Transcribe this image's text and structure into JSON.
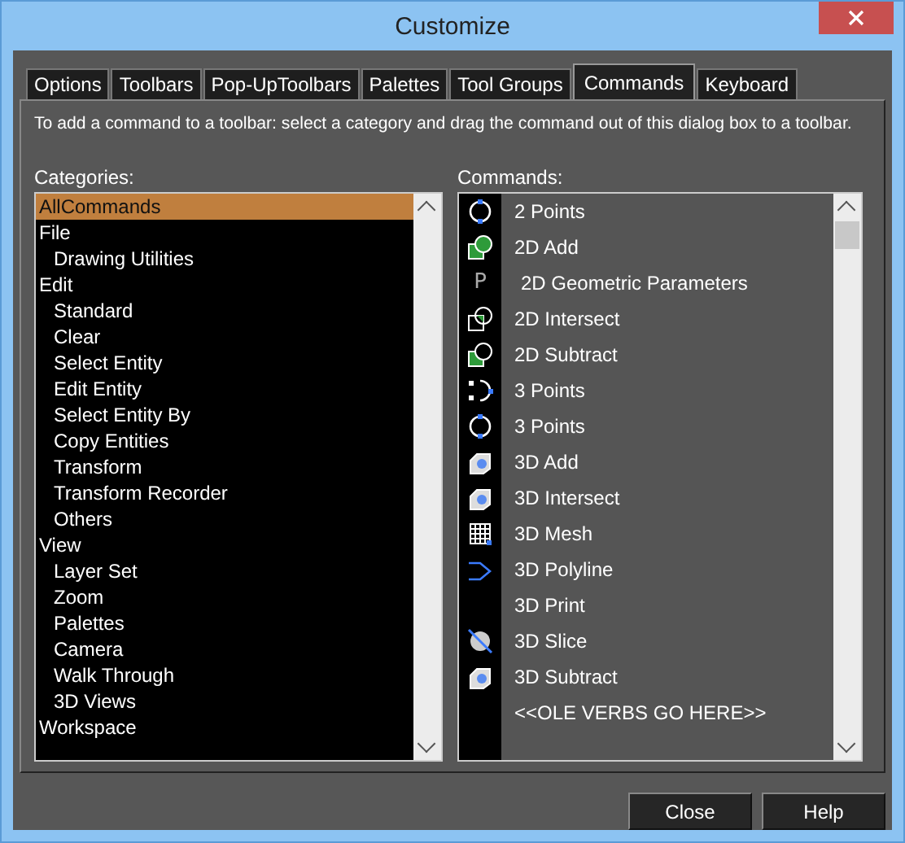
{
  "window": {
    "title": "Customize"
  },
  "tabs": [
    {
      "label": "Options",
      "selected": false
    },
    {
      "label": "Toolbars",
      "selected": false
    },
    {
      "label": "Pop-UpToolbars",
      "selected": false
    },
    {
      "label": "Palettes",
      "selected": false
    },
    {
      "label": "Tool Groups",
      "selected": false
    },
    {
      "label": "Commands",
      "selected": true
    },
    {
      "label": "Keyboard",
      "selected": false
    }
  ],
  "instruction": "To add a command to a toolbar: select a category and drag the command out of this dialog box to a toolbar.",
  "categories": {
    "label": "Categories:",
    "items": [
      {
        "label": "AllCommands",
        "selected": true
      },
      {
        "label": "File",
        "selected": false,
        "children": [
          {
            "label": "Drawing Utilities",
            "selected": false
          }
        ]
      },
      {
        "label": "Edit",
        "selected": false,
        "children": [
          {
            "label": "Standard",
            "selected": false
          },
          {
            "label": "Clear",
            "selected": false
          },
          {
            "label": "Select Entity",
            "selected": false
          },
          {
            "label": "Edit Entity",
            "selected": false
          },
          {
            "label": "Select Entity By",
            "selected": false
          },
          {
            "label": "Copy Entities",
            "selected": false
          },
          {
            "label": "Transform",
            "selected": false
          },
          {
            "label": "Transform Recorder",
            "selected": false
          },
          {
            "label": "Others",
            "selected": false
          }
        ]
      },
      {
        "label": "View",
        "selected": false,
        "children": [
          {
            "label": "Layer Set",
            "selected": false
          },
          {
            "label": "Zoom",
            "selected": false
          },
          {
            "label": "Palettes",
            "selected": false
          },
          {
            "label": "Camera",
            "selected": false
          },
          {
            "label": "Walk Through",
            "selected": false
          },
          {
            "label": "3D Views",
            "selected": false
          }
        ]
      },
      {
        "label": "Workspace",
        "selected": false
      }
    ]
  },
  "commands": {
    "label": "Commands:",
    "items": [
      {
        "label": "2 Points",
        "kind": "circle"
      },
      {
        "label": "2D Add",
        "kind": "add2d"
      },
      {
        "label": "2D Geometric Parameters",
        "kind": "letter",
        "glyph": "P"
      },
      {
        "label": "2D Intersect",
        "kind": "intersect2d"
      },
      {
        "label": "2D Subtract",
        "kind": "subtract2d"
      },
      {
        "label": "3 Points",
        "kind": "numbered"
      },
      {
        "label": "3 Points",
        "kind": "circle"
      },
      {
        "label": "3D Add",
        "kind": "solid"
      },
      {
        "label": "3D Intersect",
        "kind": "solid"
      },
      {
        "label": "3D Mesh",
        "kind": "mesh"
      },
      {
        "label": "3D Polyline",
        "kind": "polyline"
      },
      {
        "label": "3D Print",
        "kind": "none"
      },
      {
        "label": "3D Slice",
        "kind": "slice"
      },
      {
        "label": "3D Subtract",
        "kind": "solid"
      },
      {
        "label": "<<OLE VERBS GO HERE>>",
        "kind": "none"
      }
    ]
  },
  "buttons": [
    {
      "label": "Close"
    },
    {
      "label": "Help"
    }
  ]
}
